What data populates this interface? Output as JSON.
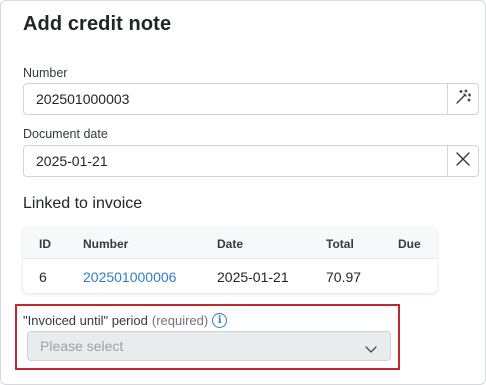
{
  "dialog": {
    "title": "Add credit note"
  },
  "number_field": {
    "label": "Number",
    "value": "202501000003",
    "action_icon": "magic-wand-icon"
  },
  "document_date_field": {
    "label": "Document date",
    "value": "2025-01-21",
    "action_icon": "close-icon"
  },
  "linked_invoice": {
    "title": "Linked to invoice",
    "columns": [
      "ID",
      "Number",
      "Date",
      "Total",
      "Due"
    ],
    "rows": [
      {
        "id": "6",
        "number": "202501000006",
        "date": "2025-01-21",
        "total": "70.97",
        "due": ""
      }
    ]
  },
  "invoiced_until": {
    "label": "\"Invoiced until\" period",
    "required_text": "(required)",
    "info_icon": "info-icon",
    "placeholder": "Please select",
    "highlight_color": "#c0282d"
  },
  "colors": {
    "link": "#2f80c8",
    "text": "#212529",
    "border": "#ced4da"
  }
}
